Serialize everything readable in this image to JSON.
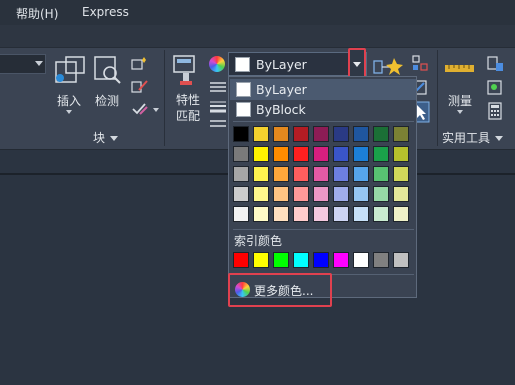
{
  "menubar": {
    "items": [
      "帮助(H)",
      "Express"
    ]
  },
  "ribbon": {
    "insert_label": "插入",
    "check_label": "检测",
    "block_panel_title": "块",
    "match_label_line1": "特性",
    "match_label_line2": "匹配",
    "measure_label": "测量",
    "utilities_panel_title": "实用工具"
  },
  "color_combo": {
    "value": "ByLayer"
  },
  "dropdown": {
    "items": [
      {
        "label": "ByLayer",
        "swatch": "#ffffff",
        "selected": true
      },
      {
        "label": "ByBlock",
        "swatch": "#ffffff",
        "selected": false
      }
    ],
    "palette_rows": [
      [
        "#000000",
        "#f3d12e",
        "#e3881e",
        "#b31c24",
        "#8d1c55",
        "#2a3a84",
        "#1f569f",
        "#1b6f36",
        "#7b8134"
      ],
      [
        "#7a7a7a",
        "#fff200",
        "#ff8c00",
        "#ff2020",
        "#d61f7f",
        "#3a55c8",
        "#1c7fd8",
        "#1aa14a",
        "#b6c12c"
      ],
      [
        "#a6a6a6",
        "#fff44f",
        "#ffa73b",
        "#ff5e5e",
        "#e35aa4",
        "#6d7fe0",
        "#56a5ec",
        "#58c272",
        "#d2d85a"
      ],
      [
        "#cccccc",
        "#fff88c",
        "#ffc483",
        "#ff9999",
        "#ec98c6",
        "#a0adeb",
        "#96c6f2",
        "#96d9a6",
        "#e3e79a"
      ],
      [
        "#f2f2f2",
        "#fffbc7",
        "#ffe0c0",
        "#ffcccc",
        "#f3c8df",
        "#cdd4f3",
        "#c7e0f8",
        "#c9ebd0",
        "#eff1c8"
      ]
    ],
    "index_title": "索引颜色",
    "index_colors": [
      "#ff0000",
      "#ffff00",
      "#00ff00",
      "#00ffff",
      "#0000ff",
      "#ff00ff",
      "#ffffff",
      "#808080",
      "#c0c0c0"
    ],
    "more_colors_label": "更多颜色..."
  }
}
